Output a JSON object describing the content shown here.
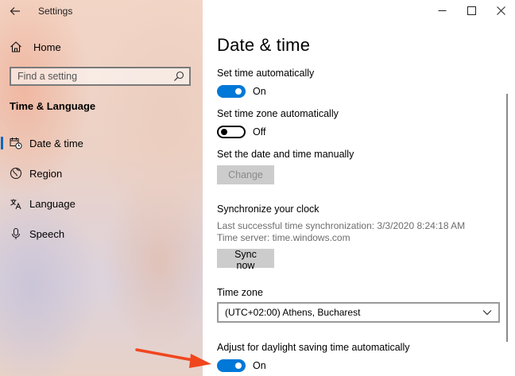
{
  "app": {
    "title": "Settings"
  },
  "sidebar": {
    "home_label": "Home",
    "search_placeholder": "Find a setting",
    "section_title": "Time & Language",
    "items": [
      {
        "label": "Date & time",
        "icon": "calendar-clock-icon",
        "selected": true
      },
      {
        "label": "Region",
        "icon": "globe-icon",
        "selected": false
      },
      {
        "label": "Language",
        "icon": "language-icon",
        "selected": false
      },
      {
        "label": "Speech",
        "icon": "microphone-icon",
        "selected": false
      }
    ]
  },
  "main": {
    "page_title": "Date & time",
    "set_time_auto": {
      "label": "Set time automatically",
      "state": "On",
      "on": true
    },
    "set_timezone_auto": {
      "label": "Set time zone automatically",
      "state": "Off",
      "on": false
    },
    "manual": {
      "label": "Set the date and time manually",
      "button": "Change"
    },
    "sync": {
      "heading": "Synchronize your clock",
      "last_sync": "Last successful time synchronization: 3/3/2020 8:24:18 AM",
      "server": "Time server: time.windows.com",
      "button": "Sync now"
    },
    "timezone": {
      "label": "Time zone",
      "value": "(UTC+02:00) Athens, Bucharest"
    },
    "dst": {
      "label": "Adjust for daylight saving time automatically",
      "state": "On",
      "on": true
    }
  },
  "colors": {
    "accent": "#0078d7",
    "annotation_arrow": "#f0461e"
  }
}
